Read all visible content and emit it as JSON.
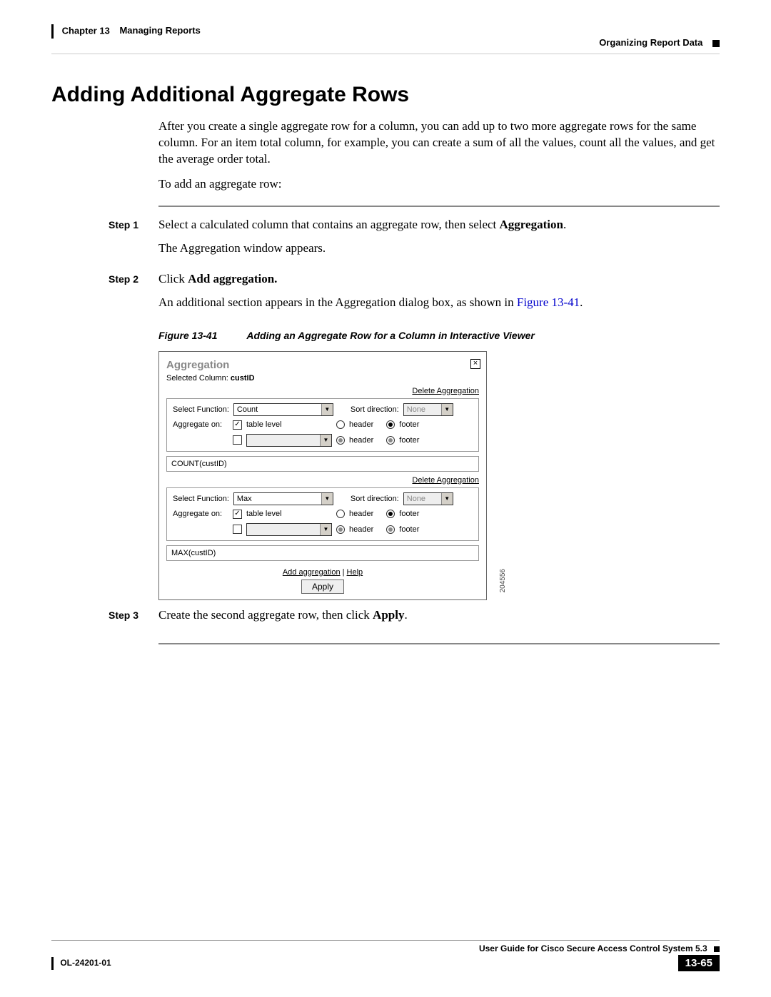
{
  "header": {
    "chapter_no": "Chapter 13",
    "chapter_title": "Managing Reports",
    "section": "Organizing Report Data"
  },
  "title": "Adding Additional Aggregate Rows",
  "intro": {
    "p1": "After you create a single aggregate row for a column, you can add up to two more aggregate rows for the same column. For an item total column, for example, you can create a sum of all the values, count all the values, and get the average order total.",
    "p2": "To add an aggregate row:"
  },
  "steps": {
    "s1": {
      "label": "Step 1",
      "t1a": "Select a calculated column that contains an aggregate row, then select ",
      "t1b": "Aggregation",
      "t1c": ".",
      "t2": "The Aggregation window appears."
    },
    "s2": {
      "label": "Step 2",
      "t1a": "Click ",
      "t1b": "Add aggregation.",
      "t2a": "An additional section appears in the Aggregation dialog box, as shown in ",
      "t2b": "Figure 13-41",
      "t2c": "."
    },
    "s3": {
      "label": "Step 3",
      "t1a": "Create the second aggregate row, then click ",
      "t1b": "Apply",
      "t1c": "."
    }
  },
  "figure": {
    "no": "Figure 13-41",
    "caption": "Adding an Aggregate Row for a Column in Interactive Viewer",
    "image_id": "204556"
  },
  "dialog": {
    "title": "Aggregation",
    "close": "×",
    "selected_label": "Selected Column: ",
    "selected_value": "custID",
    "delete": "Delete Aggregation",
    "select_function": "Select Function:",
    "sort_direction": "Sort direction:",
    "sort_none": "None",
    "aggregate_on": "Aggregate on:",
    "table_level": "table level",
    "header": "header",
    "footer": "footer",
    "agg1": {
      "func": "Count",
      "result": "COUNT(custID)"
    },
    "agg2": {
      "func": "Max",
      "result": "MAX(custID)"
    },
    "add_link": "Add aggregation",
    "help_link": "Help",
    "apply": "Apply"
  },
  "footer": {
    "guide": "User Guide for Cisco Secure Access Control System 5.3",
    "doc_no": "OL-24201-01",
    "page": "13-65"
  }
}
